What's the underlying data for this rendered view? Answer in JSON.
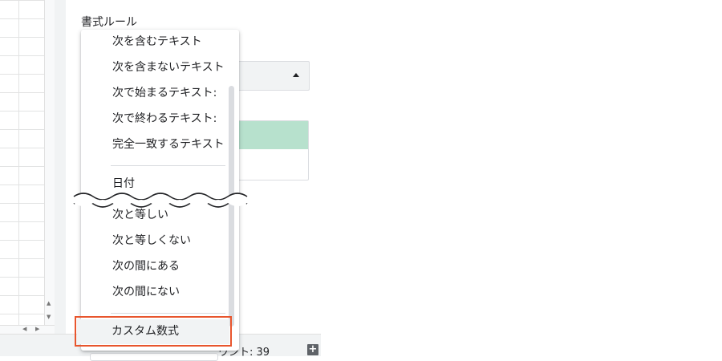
{
  "panel": {
    "title": "書式ルール"
  },
  "menu": {
    "items": [
      "次を含むテキスト",
      "次を含まないテキスト",
      "次で始まるテキスト:",
      "次で終わるテキスト:",
      "完全一致するテキスト",
      "日付",
      "次と等しい",
      "次と等しくない",
      "次の間にある",
      "次の間にない"
    ],
    "selected": "カスタム数式"
  },
  "status": {
    "count": "ウント: 39"
  },
  "colors": {
    "preview_fill": "#b7e1cd",
    "highlight_border": "#e8552d"
  }
}
